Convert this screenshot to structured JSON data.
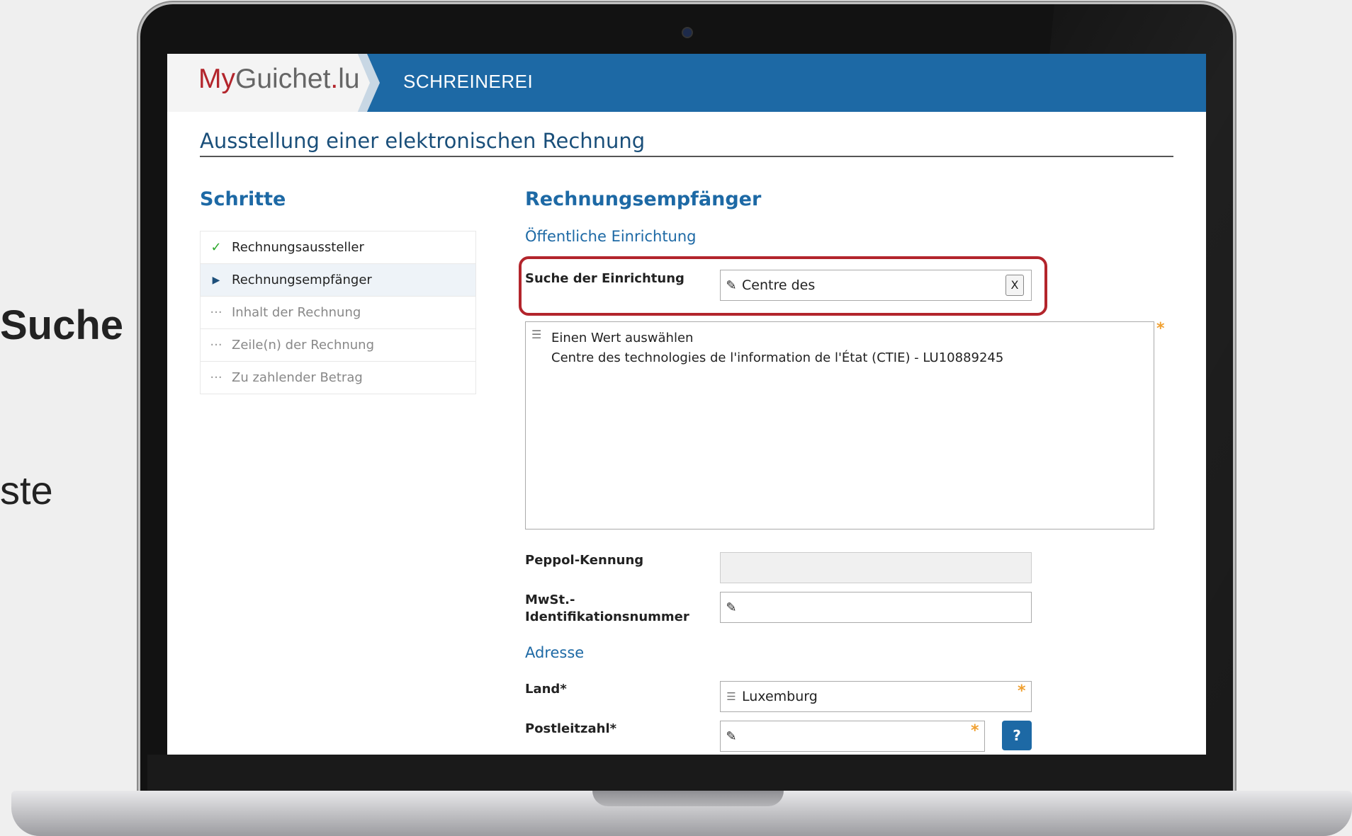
{
  "slide": {
    "partial_text_1": "Suche",
    "partial_text_2": "ste"
  },
  "header": {
    "logo_my": "My",
    "logo_guichet": "Guichet",
    "logo_dot": ".",
    "logo_lu": "lu",
    "section_title": "SCHREINEREI"
  },
  "page": {
    "title": "Ausstellung einer elektronischen Rechnung"
  },
  "steps": {
    "heading": "Schritte",
    "items": [
      {
        "label": "Rechnungsaussteller",
        "icon": "✓",
        "state": "done"
      },
      {
        "label": "Rechnungsempfänger",
        "icon": "▶",
        "state": "active"
      },
      {
        "label": "Inhalt der Rechnung",
        "icon": "···",
        "state": "todo"
      },
      {
        "label": "Zeile(n) der Rechnung",
        "icon": "···",
        "state": "todo"
      },
      {
        "label": "Zu zahlender Betrag",
        "icon": "···",
        "state": "todo"
      }
    ]
  },
  "form": {
    "heading": "Rechnungsempfänger",
    "section_public": "Öffentliche Einrichtung",
    "search_label": "Suche der Einrichtung",
    "search_value": "Centre des",
    "clear_label": "X",
    "list_options": [
      "Einen Wert auswählen",
      "Centre des technologies de l'information de l'État (CTIE) - LU10889245"
    ],
    "peppol_label": "Peppol-Kennung",
    "peppol_value": "",
    "vat_label_line1": "MwSt.-",
    "vat_label_line2": "Identifikationsnummer",
    "vat_value": "",
    "section_address": "Adresse",
    "country_label": "Land*",
    "country_value": "Luxemburg",
    "postcode_label": "Postleitzahl*",
    "postcode_value": "",
    "required_mark": "*",
    "help_label": "?"
  },
  "colors": {
    "brand_blue": "#1d69a5",
    "brand_red": "#b3252c",
    "required_orange": "#f0a030",
    "done_green": "#2aa72a"
  }
}
